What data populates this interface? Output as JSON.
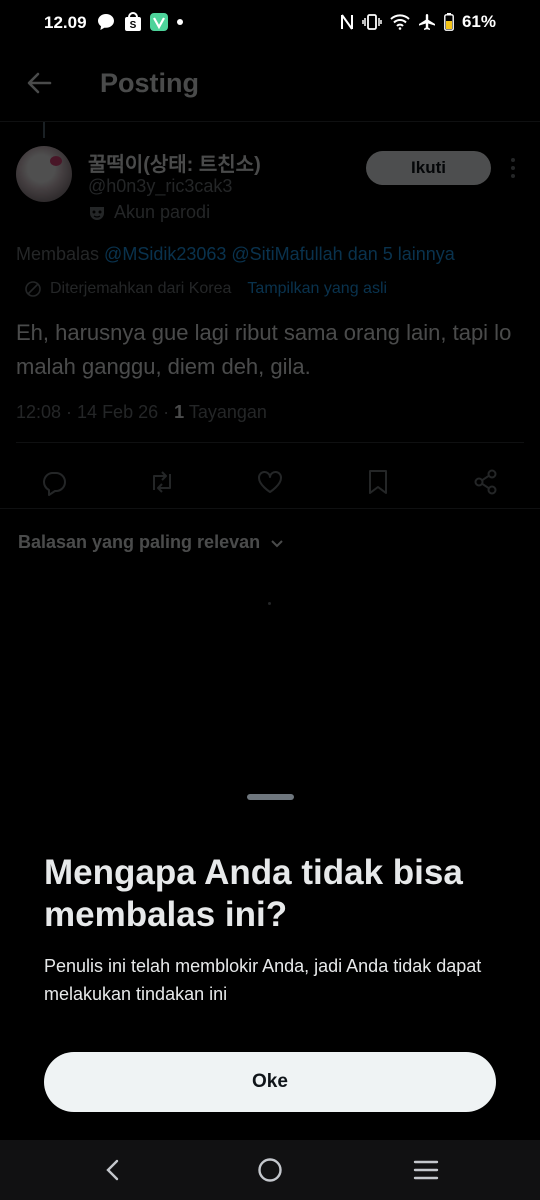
{
  "status_bar": {
    "time": "12.09",
    "battery": "61%",
    "icons_left": [
      "chat-bubble-icon",
      "shopee-icon",
      "vpn-app-icon",
      "dot-icon"
    ],
    "icons_right": [
      "nfc-icon",
      "vibrate-icon",
      "wifi-icon",
      "airplane-icon",
      "battery-icon"
    ]
  },
  "header": {
    "title": "Posting"
  },
  "tweet": {
    "display_name": "꿀떡이(상태: 트친소)",
    "handle": "@h0n3y_ric3cak3",
    "badge": "Akun parodi",
    "follow_label": "Ikuti",
    "reply_prefix": "Membalas",
    "reply_mentions": "@MSidik23063 @SitiMafullah dan 5 lainnya",
    "translated_label": "Diterjemahkan dari Korea",
    "show_original_label": "Tampilkan yang asli",
    "text": "Eh, harusnya gue lagi ribut sama orang lain, tapi lo malah ganggu, diem deh, gila.",
    "time_date": "12:08 · 14 Feb 26 · ",
    "views_count": "1",
    "views_label": "Tayangan"
  },
  "replies": {
    "sort_label": "Balasan yang paling relevan"
  },
  "sheet": {
    "title": "Mengapa Anda tidak bisa membalas ini?",
    "body": "Penulis ini telah memblokir Anda, jadi Anda tidak dapat melakukan tindakan ini",
    "ok_label": "Oke"
  },
  "colors": {
    "accent": "#1d9bf0",
    "background": "#000000",
    "muted": "#71767b"
  }
}
